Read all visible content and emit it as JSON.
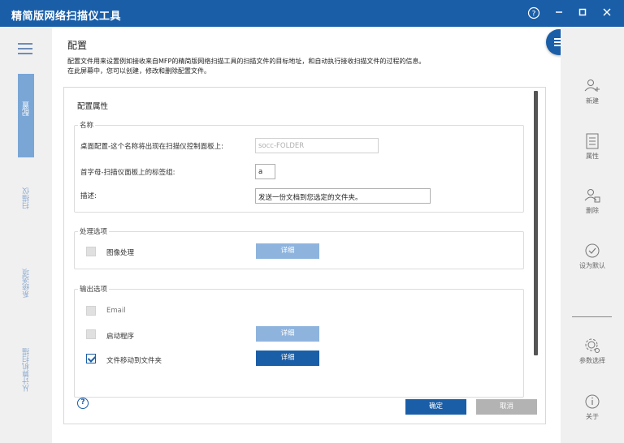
{
  "app": {
    "title": "精简版网络扫描仪工具"
  },
  "window_controls": {
    "help": "?",
    "minimize": "—",
    "maximize": "□",
    "close": "✕"
  },
  "left_nav": {
    "tabs": [
      {
        "label": "配置",
        "active": true
      },
      {
        "label": "扫描仪",
        "active": false
      },
      {
        "label": "系统选项",
        "active": false
      },
      {
        "label": "从计算机扫描",
        "active": false
      }
    ]
  },
  "page": {
    "title": "配置",
    "description_line1": "配置文件用来设置例如接收来自MFP的精简版网络扫描工具的扫描文件的目标地址，和自动执行接收扫描文件的过程的信息。",
    "description_line2": "在此屏幕中，您可以创建，修改和删除配置文件。"
  },
  "config": {
    "panel_title": "配置属性",
    "name_group": {
      "label": "名称",
      "desktop_label": "桌面配置-这个名称将出现在扫描仪控制面板上:",
      "desktop_value": "socc-FOLDER",
      "initial_label": "首字母-扫描仪面板上的标签组:",
      "initial_value": "a",
      "desc_label": "描述:",
      "desc_value": "发送一份文档到您选定的文件夹。"
    },
    "process_group": {
      "label": "处理选项",
      "image_label": "图像处理",
      "image_checked": false,
      "detail_label": "详细"
    },
    "output_group": {
      "label": "输出选项",
      "items": [
        {
          "label": "Email",
          "checked": false
        },
        {
          "label": "启动程序",
          "checked": false,
          "detail": "详细"
        },
        {
          "label": "文件移动到文件夹",
          "checked": true,
          "detail": "详细"
        }
      ]
    },
    "ok_label": "确定",
    "cancel_label": "取消",
    "help_icon_text": "?"
  },
  "right_toolbar": {
    "new": "新建",
    "properties": "属性",
    "delete": "删除",
    "set_default": "设为默认",
    "settings": "参数选择",
    "about": "关于"
  },
  "colors": {
    "brand": "#1a5ea8",
    "light_button": "#8eb4de",
    "nav_active": "#7aa6d6"
  }
}
